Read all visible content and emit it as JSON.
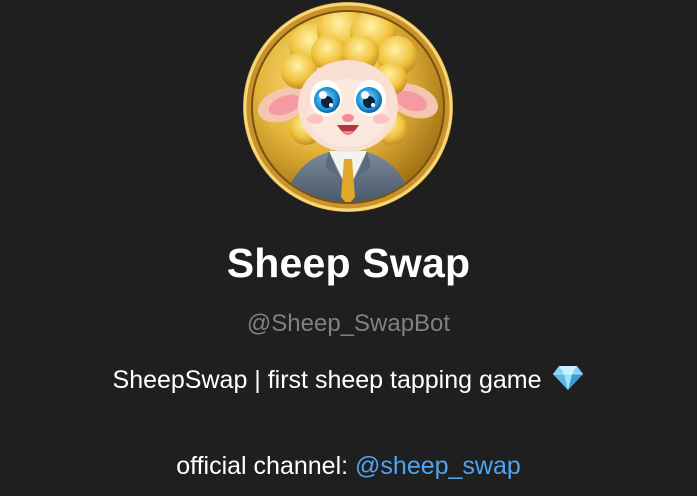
{
  "profile": {
    "avatar_icon": "sheep-coin-avatar",
    "name": "Sheep Swap",
    "username": "@Sheep_SwapBot",
    "bio": "SheepSwap | first sheep tapping game",
    "bio_emoji_icon": "diamond-icon",
    "channel_label": "official channel: ",
    "channel_link": "@sheep_swap"
  },
  "colors": {
    "background": "#1f1f20",
    "muted_text": "#7f8084",
    "link": "#4ea4f0"
  }
}
